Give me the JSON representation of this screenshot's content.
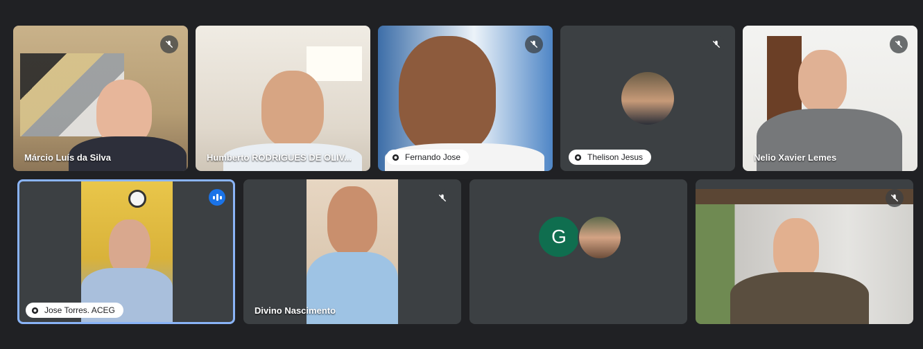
{
  "participants": [
    {
      "name": "Márcio Luís da Silva",
      "mic": "muted-icon"
    },
    {
      "name": "Humberto RODRIGUES DE OLIV...",
      "mic": "none"
    },
    {
      "name": "Fernando Jose",
      "mic": "muted-icon"
    },
    {
      "name": "Thelison Jesus",
      "mic": "muted-icon"
    },
    {
      "name": "Nelio Xavier Lemes",
      "mic": "muted-icon"
    },
    {
      "name": "Jose Torres. ACEG",
      "mic": "speaking-indicator"
    },
    {
      "name": "Divino Nascimento",
      "mic": "muted-icon"
    },
    {
      "name": "",
      "avatar_letter": "G",
      "mic": "none"
    },
    {
      "name": "",
      "mic": "muted-icon"
    }
  ],
  "colors": {
    "background": "#202124",
    "tile": "#3c4043",
    "speaking_outline": "#8ab4f8",
    "indicator": "#1a73e8",
    "avatar_g": "#0f6e4f"
  }
}
